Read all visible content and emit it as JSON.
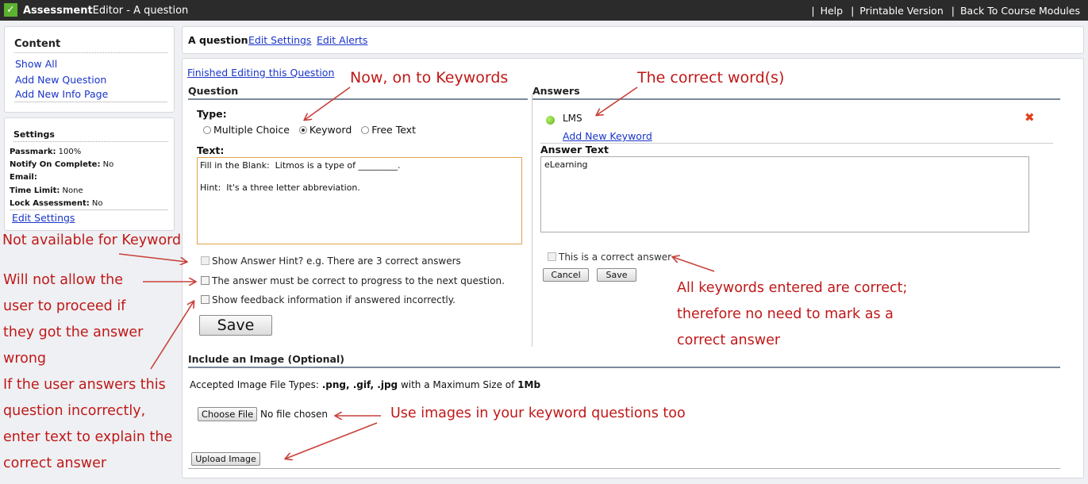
{
  "topbar": {
    "app_bold": "Assessment",
    "app_rest": "Editor",
    "page": " - A question",
    "links": [
      "Help",
      "Printable Version",
      "Back To Course Modules"
    ]
  },
  "content_panel": {
    "title": "Content",
    "items": [
      "Show All",
      "Add New Question",
      "Add New Info Page"
    ]
  },
  "settings_panel": {
    "title": "Settings",
    "rows": [
      {
        "label": "Passmark:",
        "value": "100%"
      },
      {
        "label": "Notify On Complete:",
        "value": "No"
      },
      {
        "label": "Email:",
        "value": ""
      },
      {
        "label": "Time Limit:",
        "value": "None"
      },
      {
        "label": "Lock Assessment:",
        "value": "No"
      }
    ],
    "edit_link": "Edit Settings"
  },
  "header": {
    "question_name": "A question",
    "edit_settings": "Edit Settings",
    "edit_alerts": "Edit Alerts"
  },
  "question": {
    "finished_link": "Finished Editing this Question",
    "section_title": "Question",
    "type_label": "Type:",
    "types": [
      "Multiple Choice",
      "Keyword",
      "Free Text"
    ],
    "selected_type": "Keyword",
    "text_label": "Text:",
    "text_value": "Fill in the Blank:  Litmos is a type of _________.\n\nHint:  It's a three letter abbreviation.",
    "options": [
      {
        "label": "Show Answer Hint? e.g. There are 3 correct answers",
        "checked": false,
        "disabled": true
      },
      {
        "label": "The answer must be correct to progress to the next question.",
        "checked": false,
        "disabled": false
      },
      {
        "label": "Show feedback information if answered incorrectly.",
        "checked": false,
        "disabled": false
      }
    ],
    "save_label": "Save"
  },
  "answers": {
    "section_title": "Answers",
    "items": [
      {
        "text": "LMS",
        "status_color": "#6cc12a"
      }
    ],
    "add_link": "Add New Keyword",
    "answer_text_label": "Answer Text",
    "answer_text_value": "eLearning",
    "correct_label": "This is a correct answer",
    "cancel_label": "Cancel",
    "save_label": "Save"
  },
  "image_section": {
    "title": "Include an Image (Optional)",
    "types_prefix": "Accepted Image File Types: ",
    "types_bold": ".png, .gif, .jpg",
    "size_prefix": " with a Maximum Size of ",
    "size_bold": "1Mb",
    "choose_label": "Choose File",
    "no_file": "No file chosen",
    "upload_label": "Upload Image"
  },
  "annotations": {
    "keywords": "Now, on to Keywords",
    "correct_words": "The correct word(s)",
    "not_available": "Not available for Keyword",
    "will_not_allow": [
      "Will not allow the",
      "user to proceed if",
      "they got the answer",
      "wrong"
    ],
    "feedback": [
      "If the user answers this",
      "question incorrectly,",
      "enter text to explain the",
      "correct answer"
    ],
    "all_keywords": [
      "All keywords entered are correct;",
      "therefore no need to mark as a",
      "correct answer"
    ],
    "images": "Use images in your keyword questions too"
  }
}
